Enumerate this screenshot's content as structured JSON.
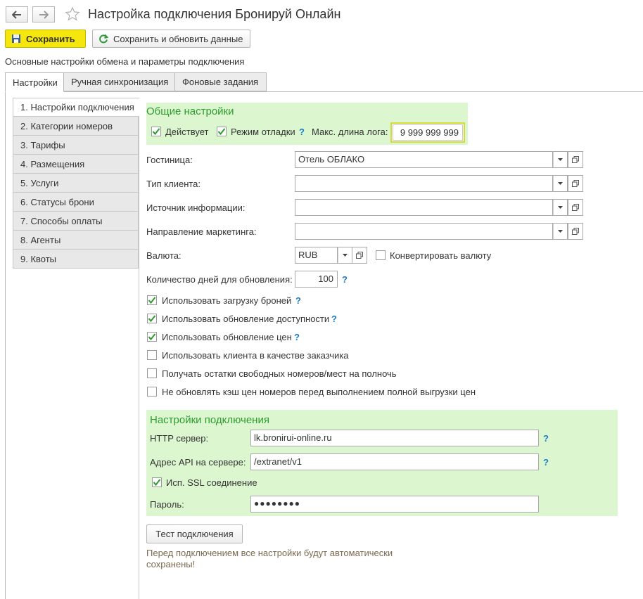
{
  "window": {
    "title": "Настройка подключения Бронируй Онлайн",
    "back_icon": "arrow-left-icon",
    "forward_icon": "arrow-right-icon",
    "favorite_icon": "star-icon"
  },
  "toolbar": {
    "save_label": "Сохранить",
    "save_refresh_label": "Сохранить и обновить данные"
  },
  "subtitle": "Основные настройки обмена и параметры подключения",
  "tabs": [
    {
      "label": "Настройки",
      "active": true
    },
    {
      "label": "Ручная синхронизация",
      "active": false
    },
    {
      "label": "Фоновые задания",
      "active": false
    }
  ],
  "sidebar": {
    "items": [
      {
        "label": "1. Настройки подключения",
        "active": true
      },
      {
        "label": "2. Категории номеров"
      },
      {
        "label": "3. Тарифы"
      },
      {
        "label": "4. Размещения"
      },
      {
        "label": "5. Услуги"
      },
      {
        "label": "6. Статусы брони"
      },
      {
        "label": "7. Способы оплаты"
      },
      {
        "label": "8. Агенты"
      },
      {
        "label": "9. Квоты"
      }
    ]
  },
  "general": {
    "title": "Общие настройки",
    "active_label": "Действует",
    "active_checked": true,
    "debug_label": "Режим отладки",
    "debug_checked": true,
    "help": "?",
    "max_log_label": "Макс. длина лога:",
    "max_log_value": "9 999 999 999",
    "hotel_label": "Гостиница:",
    "hotel_value": "Отель ОБЛАКО",
    "client_type_label": "Тип клиента:",
    "client_type_value": "",
    "info_source_label": "Источник информации:",
    "info_source_value": "",
    "marketing_label": "Направление маркетинга:",
    "marketing_value": "",
    "currency_label": "Валюта:",
    "currency_value": "RUB",
    "convert_label": "Конвертировать валюту",
    "convert_checked": false,
    "days_label": "Количество дней для обновления:",
    "days_value": "100",
    "options": [
      {
        "label": "Использовать загрузку броней",
        "checked": true,
        "help": true
      },
      {
        "label": "Использовать обновление доступности",
        "checked": true,
        "help": true
      },
      {
        "label": "Использовать обновление цен",
        "checked": true,
        "help": true
      },
      {
        "label": "Использовать клиента в качестве заказчика",
        "checked": false,
        "help": false
      },
      {
        "label": "Получать остатки свободных номеров/мест на полночь",
        "checked": false,
        "help": false
      },
      {
        "label": "Не обновлять кэш цен номеров перед выполнением полной выгрузки цен",
        "checked": false,
        "help": false
      }
    ]
  },
  "connection": {
    "title": "Настройки подключения",
    "http_label": "HTTP сервер:",
    "http_value": "lk.bronirui-online.ru",
    "api_label": "Адрес API на сервере:",
    "api_value": "/extranet/v1",
    "ssl_label": "Исп. SSL соединение",
    "ssl_checked": true,
    "password_label": "Пароль:",
    "password_value": "●●●●●●●●",
    "help": "?"
  },
  "test_button_label": "Тест подключения",
  "note": "Перед подключением все настройки будут автоматически сохранены!",
  "colors": {
    "save_button": "#f5e60e",
    "section_title": "#2f9b2f",
    "connection_bg": "#dcf7d0",
    "help": "#1a7acb",
    "check": "#2f9b2f",
    "note": "#7a6a4f"
  }
}
